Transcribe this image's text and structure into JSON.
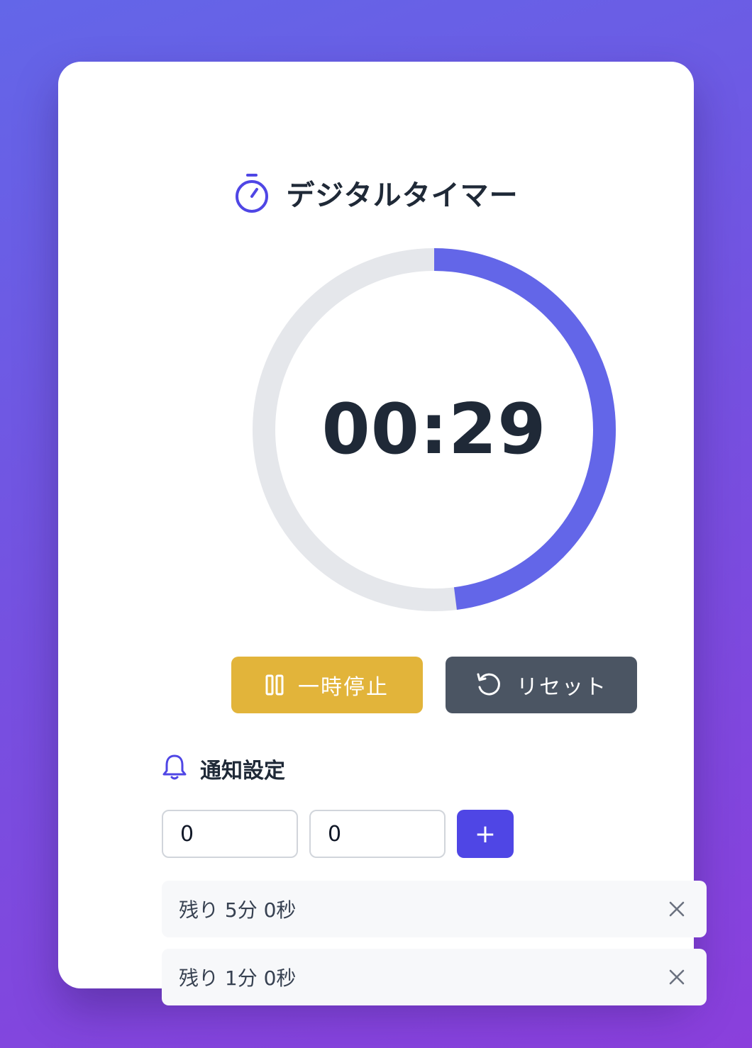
{
  "app": {
    "title": "デジタルタイマー"
  },
  "timer": {
    "display": "00:29",
    "progress_fraction": 0.48,
    "progress_color": "#6366e8",
    "track_color": "#e5e7eb"
  },
  "controls": {
    "pause_label": "一時停止",
    "reset_label": "リセット",
    "pause_color": "#e2b43a",
    "reset_color": "#4b5563"
  },
  "notifications": {
    "heading": "通知設定",
    "minutes_value": "0",
    "seconds_value": "0",
    "add_label": "+",
    "items": [
      {
        "label": "残り 5分 0秒"
      },
      {
        "label": "残り 1分 0秒"
      }
    ]
  },
  "icons": {
    "title": "stopwatch-icon",
    "pause": "pause-icon",
    "reset": "rotate-ccw-icon",
    "notify": "bell-icon",
    "remove": "close-icon"
  }
}
